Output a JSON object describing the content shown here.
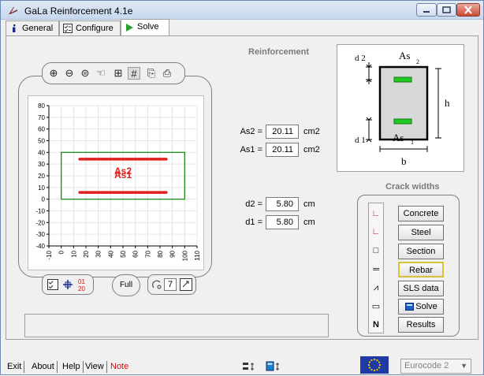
{
  "window": {
    "title": "GaLa Reinforcement  4.1e"
  },
  "tabs": [
    {
      "label": "General",
      "icon": "info-icon"
    },
    {
      "label": "Configure",
      "icon": "checklist-icon"
    },
    {
      "label": "Solve",
      "icon": "play-icon"
    }
  ],
  "reinforcement": {
    "title": "Reinforcement"
  },
  "chart_data": {
    "type": "scatter",
    "title": "",
    "xlabel": "",
    "ylabel": "",
    "xlim": [
      -10,
      110
    ],
    "ylim": [
      -40,
      80
    ],
    "x_ticks": [
      "-10",
      "0",
      "10",
      "20",
      "30",
      "40",
      "50",
      "60",
      "70",
      "80",
      "90",
      "100",
      "110"
    ],
    "y_ticks": [
      "80",
      "70",
      "60",
      "50",
      "40",
      "30",
      "20",
      "10",
      "0",
      "-10",
      "-20",
      "-30",
      "-40"
    ],
    "section_rect": {
      "x": [
        0,
        100
      ],
      "y": [
        0,
        40
      ]
    },
    "bars": [
      {
        "name": "As2",
        "y": 34.2,
        "x": [
          15,
          85
        ]
      },
      {
        "name": "As1",
        "y": 5.8,
        "x": [
          15,
          85
        ]
      }
    ],
    "labels": [
      "As2",
      "As1"
    ],
    "grid": true,
    "colors": {
      "section": "#1a8a1a",
      "rebar": "#e02020"
    }
  },
  "fields": {
    "as2": {
      "label": "As2 =",
      "value": "20.11",
      "unit": "cm2"
    },
    "as1": {
      "label": "As1 =",
      "value": "20.11",
      "unit": "cm2"
    },
    "d2": {
      "label": "d2 =",
      "value": "5.80",
      "unit": "cm"
    },
    "d1": {
      "label": "d1 =",
      "value": "5.80",
      "unit": "cm"
    }
  },
  "section_image": {
    "d2": "d 2",
    "d1": "d 1",
    "as_top": "As",
    "as_top_sub": "2",
    "as_bot": "As",
    "as_bot_sub": "1",
    "h": "h",
    "b": "b"
  },
  "crack": {
    "title": "Crack widths",
    "buttons": [
      "Concrete",
      "Steel",
      "Section",
      "Rebar",
      "SLS data",
      "Solve",
      "Results"
    ],
    "icons": [
      "concrete-icon",
      "steel-icon",
      "section-icon",
      "rebar-icon",
      "sls-icon",
      "solve-icon",
      "results-icon"
    ],
    "n_label": "N"
  },
  "bottom": {
    "full": "Full",
    "step_value": "7"
  },
  "footer": {
    "buttons": [
      "Exit",
      "About",
      "Help",
      "View",
      "Note"
    ],
    "note_color": "#d01010",
    "eurocode": "Eurocode 2"
  }
}
